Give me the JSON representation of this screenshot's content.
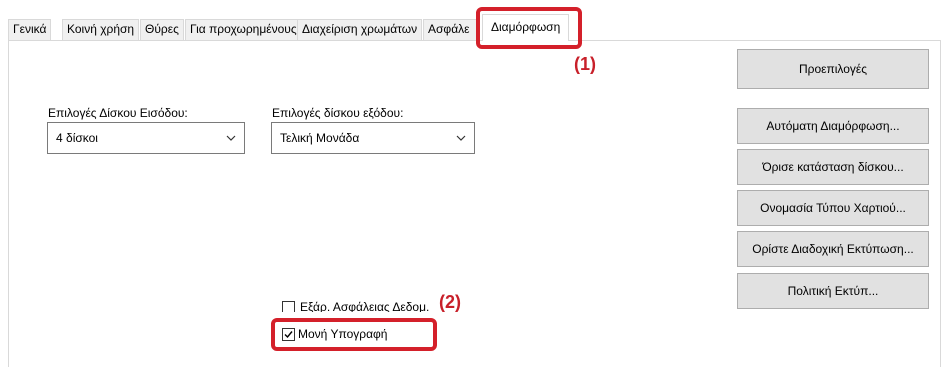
{
  "tabs": [
    {
      "label": "Γενικά"
    },
    {
      "label": "Κοινή χρήση"
    },
    {
      "label": "Θύρες"
    },
    {
      "label": "Για προχωρημένους"
    },
    {
      "label": "Διαχείριση χρωμάτων"
    },
    {
      "label": "Ασφάλε"
    },
    {
      "label": "Διαμόρφωση",
      "selected": true
    }
  ],
  "input_tray": {
    "label": "Επιλογές Δίσκου Εισόδου:",
    "value": "4 δίσκοι",
    "icon": "chevron-down-icon"
  },
  "output_tray": {
    "label": "Επιλογές δίσκου εξόδου:",
    "value": "Τελική Μονάδα",
    "icon": "chevron-down-icon"
  },
  "buttons": {
    "defaults": "Προεπιλογές",
    "auto_config": "Αυτόματη Διαμόρφωση...",
    "set_tray_status": "Όρισε κατάσταση δίσκου...",
    "paper_type_name": "Ονομασία Τύπου Χαρτιού...",
    "tandem_print": "Ορίστε Διαδοχική Εκτύπωση...",
    "print_policy": "Πολιτική Εκτύπ..."
  },
  "checkboxes": {
    "data_security": {
      "label": "Εξάρ. Ασφάλειας Δεδομ.",
      "checked": false
    },
    "single_signature": {
      "label": "Μονή Υπογραφή",
      "checked": true
    }
  },
  "annotations": {
    "marker_1": "(1)",
    "marker_2": "(2)",
    "color": "#d4202a"
  }
}
